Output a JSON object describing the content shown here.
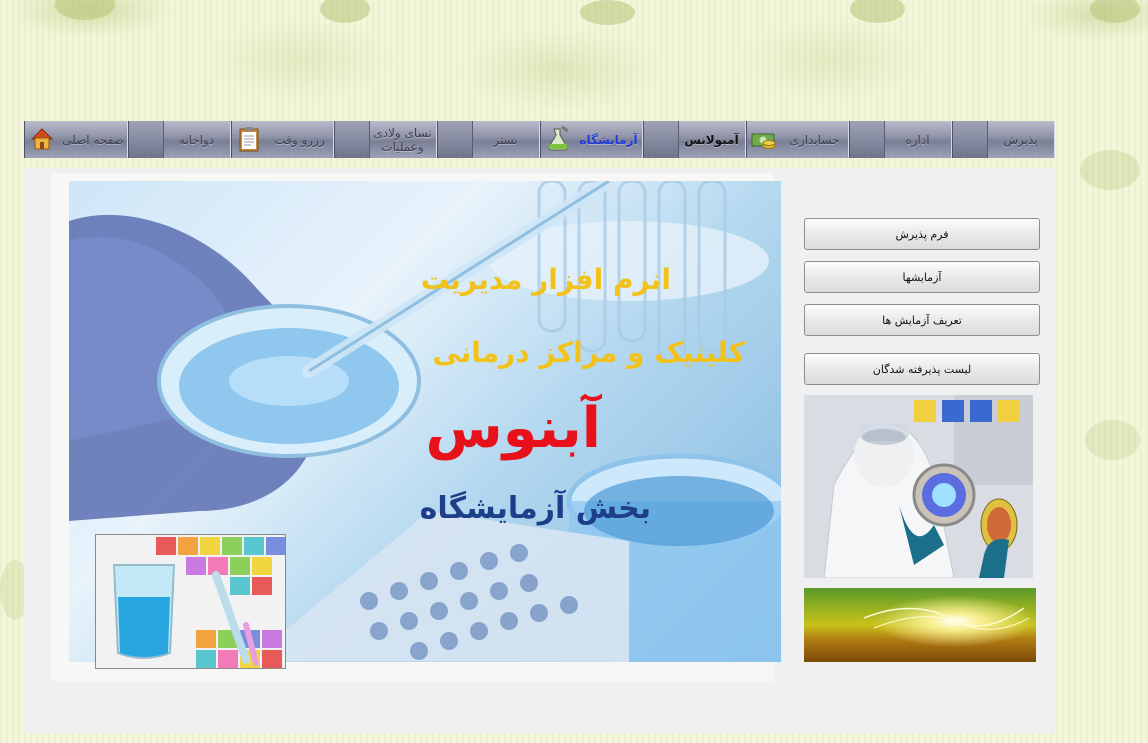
{
  "nav": {
    "items": [
      {
        "key": "admission",
        "label": "پذیرش"
      },
      {
        "key": "office",
        "label": "اداره"
      },
      {
        "key": "accounting",
        "label": "حسابداری",
        "icon": "money-icon"
      },
      {
        "key": "ambulance",
        "label": "آمبولانس"
      },
      {
        "key": "laboratory",
        "label": "آزمایشگاه",
        "icon": "flask-icon",
        "active": true
      },
      {
        "key": "inpatient",
        "label": "بستر"
      },
      {
        "key": "obstetrics",
        "label": "نسای ولادی",
        "label2": "وعملیات"
      },
      {
        "key": "reservation",
        "label": "رزرو وقت",
        "icon": "clipboard-icon"
      },
      {
        "key": "pharmacy",
        "label": "دواخانه"
      },
      {
        "key": "home",
        "label": "صفحه اصلی",
        "icon": "home-icon"
      }
    ]
  },
  "hero": {
    "line1": "انرم افزار مدیریت",
    "line2": "کلینیک و مراکز درمانی",
    "line3": "آبنوس",
    "line4": "بخش آزمایشگاه"
  },
  "sidebar": {
    "buttons": [
      {
        "label": "فرم پذیرش"
      },
      {
        "label": "آزمایشها"
      },
      {
        "label": "تعریف آزمایش ها"
      },
      {
        "label": "لیست پذیرفته شدگان"
      }
    ]
  },
  "colors": {
    "accent_yellow": "#f3c21a",
    "brand_red": "#e8101a",
    "title_blue": "#1d3f8a",
    "active_tab": "#1f3ad8"
  }
}
